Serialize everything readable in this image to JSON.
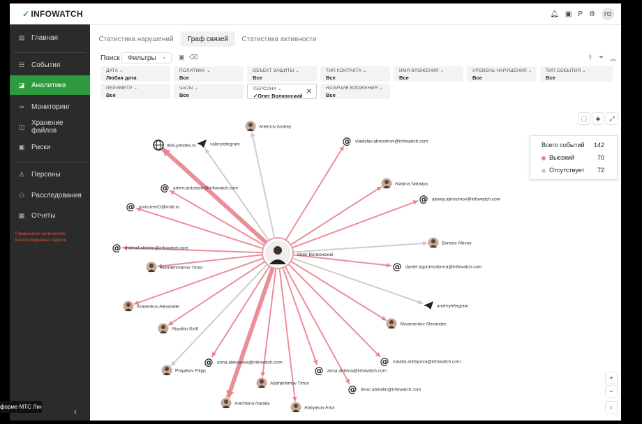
{
  "app": {
    "logo_text": "INFOWATCH"
  },
  "topbar": {
    "icons": [
      "bell-icon",
      "gift-icon",
      "p-icon",
      "gear-icon"
    ],
    "avatar_initials": "ГО"
  },
  "sidebar": {
    "items": [
      {
        "label": "Главная",
        "icon": "home-icon",
        "active": false
      },
      {
        "label": "События",
        "icon": "events-icon",
        "active": false
      },
      {
        "label": "Аналитика",
        "icon": "analytics-icon",
        "active": true
      },
      {
        "label": "Мониторинг",
        "icon": "binoculars-icon",
        "active": false
      },
      {
        "label": "Хранение файлов",
        "icon": "storage-icon",
        "active": false
      },
      {
        "label": "Риски",
        "icon": "risks-icon",
        "active": false
      },
      {
        "label": "Персоны",
        "icon": "persons-icon",
        "active": false
      },
      {
        "label": "Расследования",
        "icon": "investigations-icon",
        "active": false
      },
      {
        "label": "Отчеты",
        "icon": "reports-icon",
        "active": false
      }
    ],
    "warning": "Превышено количество контролируемых персон",
    "bottom_badge": "атформе МТС Линк"
  },
  "tabs": [
    {
      "label": "Статистика нарушений",
      "active": false
    },
    {
      "label": "Граф связей",
      "active": true
    },
    {
      "label": "Статистика активности",
      "active": false
    }
  ],
  "toolbar": {
    "search_label": "Поиск",
    "filters_label": "Фильтры"
  },
  "filters": [
    {
      "label": "Дата",
      "value": "Любая дата"
    },
    {
      "label": "Политика",
      "value": "Все"
    },
    {
      "label": "Объект защиты",
      "value": "Все"
    },
    {
      "label": "Тип контакта",
      "value": "Все"
    },
    {
      "label": "Имя вложения",
      "value": "Все"
    },
    {
      "label": "Уровень нарушения",
      "value": "Все"
    },
    {
      "label": "Тип события",
      "value": "Все"
    },
    {
      "label": "Периметр",
      "value": "Все"
    },
    {
      "label": "Часы",
      "value": "Все"
    },
    {
      "label": "Персона",
      "value": "✓Олег Волконский",
      "selected": true
    },
    {
      "label": "Наличие вложения",
      "value": "Все"
    }
  ],
  "legend": {
    "total_label": "Всего событий",
    "total_value": "142",
    "high_label": "Высокий",
    "high_value": "70",
    "none_label": "Отсутствует",
    "none_value": "72",
    "high_color": "#e8838c",
    "none_color": "#c8c8c8"
  },
  "graph": {
    "center": {
      "label": "Олег Волконский",
      "type": "person"
    },
    "nodes": [
      {
        "label": "Artemov Andrey",
        "type": "person",
        "level": "none"
      },
      {
        "label": "disk.yandex.ru",
        "type": "web",
        "level": "high",
        "weight": "heavy"
      },
      {
        "label": "valerytelegram",
        "type": "telegram",
        "level": "none"
      },
      {
        "label": "vladislav.abrosimov@infowatch.com",
        "type": "email",
        "level": "high"
      },
      {
        "label": "artem.antostein@infowatch.com",
        "type": "email",
        "level": "high"
      },
      {
        "label": "Alabina Nataliya",
        "type": "person",
        "level": "high"
      },
      {
        "label": "concurent1@mail.ru",
        "type": "email",
        "level": "high"
      },
      {
        "label": "alexey.abrosimov@infowatch.com",
        "type": "email",
        "level": "high"
      },
      {
        "label": "mikhail.alekhin@infowatch.com",
        "type": "email",
        "level": "high"
      },
      {
        "label": "Borisov Alexey",
        "type": "person",
        "level": "none"
      },
      {
        "label": "Abdrakhmanov Timur",
        "type": "person",
        "level": "high"
      },
      {
        "label": "daniel.aguirrecabrera@infowatch.com",
        "type": "email",
        "level": "high"
      },
      {
        "label": "Aravenkov Alexander",
        "type": "person",
        "level": "high"
      },
      {
        "label": "andreytelegram",
        "type": "telegram",
        "level": "none"
      },
      {
        "label": "Abashin Kirill",
        "type": "person",
        "level": "high"
      },
      {
        "label": "Aksamentov Alexander",
        "type": "person",
        "level": "high"
      },
      {
        "label": "anna.alekseeva@infowatch.com",
        "type": "email",
        "level": "high"
      },
      {
        "label": "natalia.arkhipova@infowatch.com",
        "type": "email",
        "level": "high"
      },
      {
        "label": "Polyakov Filipp",
        "type": "person",
        "level": "none"
      },
      {
        "label": "anna.anikina@infowatch.com",
        "type": "email",
        "level": "high"
      },
      {
        "label": "Abdrakhimov Timur",
        "type": "person",
        "level": "high"
      },
      {
        "label": "timur.abdullin@infowatch.com",
        "type": "email",
        "level": "high"
      },
      {
        "label": "Anichkina Natalia",
        "type": "person",
        "level": "high",
        "weight": "heavy"
      },
      {
        "label": "Abbyasov Artur",
        "type": "person",
        "level": "high"
      }
    ]
  }
}
